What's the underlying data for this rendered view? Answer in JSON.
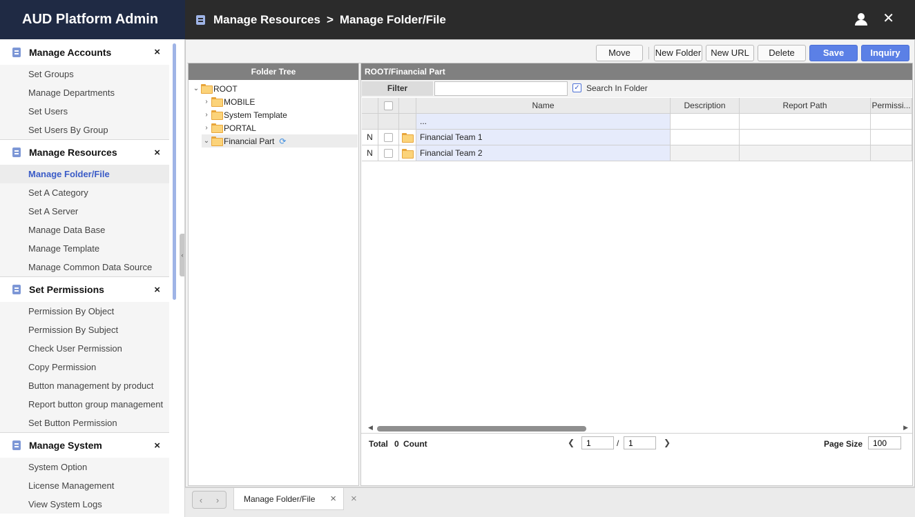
{
  "app": {
    "brand": "AUD Platform Admin",
    "breadcrumb": [
      "Manage Resources",
      "Manage Folder/File"
    ],
    "breadcrumb_sep": ">",
    "header_icons": [
      "user-icon",
      "close-icon"
    ],
    "accent_color": "#5b80e6"
  },
  "sidebar": {
    "groups": [
      {
        "title": "Manage Accounts",
        "close": "×",
        "items": [
          "Set Groups",
          "Manage Departments",
          "Set Users",
          "Set Users By Group"
        ]
      },
      {
        "title": "Manage Resources",
        "close": "×",
        "items": [
          "Manage Folder/File",
          "Set A Category",
          "Set A Server",
          "Manage Data Base",
          "Manage Template",
          "Manage Common Data Source"
        ],
        "active": "Manage Folder/File"
      },
      {
        "title": "Set Permissions",
        "close": "×",
        "items": [
          "Permission By Object",
          "Permission By Subject",
          "Check User Permission",
          "Copy Permission",
          "Button management by product",
          "Report button group management",
          "Set Button Permission"
        ]
      },
      {
        "title": "Manage System",
        "close": "×",
        "items": [
          "System Option",
          "License Management",
          "View System Logs"
        ]
      }
    ]
  },
  "toolbar": {
    "move": "Move",
    "new_folder": "New Folder",
    "new_url": "New URL",
    "delete": "Delete",
    "save": "Save",
    "inquiry": "Inquiry"
  },
  "tree": {
    "header": "Folder Tree",
    "nodes": [
      {
        "label": "ROOT",
        "expanded": true,
        "icon": "open-folder-icon"
      },
      {
        "label": "MOBILE",
        "expanded": false,
        "icon": "folder-icon"
      },
      {
        "label": "System Template",
        "expanded": false,
        "icon": "folder-icon"
      },
      {
        "label": "PORTAL",
        "expanded": false,
        "icon": "folder-icon"
      },
      {
        "label": "Financial Part",
        "expanded": true,
        "selected": true,
        "icon": "open-folder-icon",
        "refresh_icon": "refresh-icon"
      }
    ]
  },
  "grid": {
    "header": "ROOT/Financial Part",
    "filter_label": "Filter",
    "filter_value": "",
    "search_in_folder_label": "Search In Folder",
    "search_in_folder_checked": true,
    "columns": [
      "Name",
      "Description",
      "Report Path",
      "Permissi..."
    ],
    "parent_row": "...",
    "rows": [
      {
        "status": "N",
        "name": "Financial Team 1",
        "description": "",
        "report_path": "",
        "permission": ""
      },
      {
        "status": "N",
        "name": "Financial Team 2",
        "description": "",
        "report_path": "",
        "permission": ""
      }
    ]
  },
  "footer": {
    "total_label": "Total",
    "count": "0",
    "count_label": "Count",
    "page_current": "1",
    "page_sep": "/",
    "page_total": "1",
    "page_size_label": "Page Size",
    "page_size": "100"
  },
  "tabs": {
    "items": [
      {
        "label": "Manage Folder/File",
        "close": "×"
      }
    ],
    "close_all": "×"
  }
}
